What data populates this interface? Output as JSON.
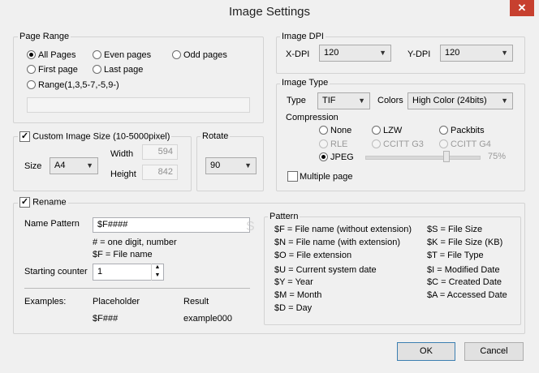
{
  "window": {
    "title": "Image Settings",
    "close_glyph": "✕"
  },
  "page_range": {
    "label": "Page Range",
    "options": [
      "All Pages",
      "Even pages",
      "Odd pages",
      "First page",
      "Last page",
      "Range(1,3,5-7,-5,9-)"
    ],
    "selected": "All Pages",
    "range_value": ""
  },
  "image_dpi": {
    "label": "Image DPI",
    "x_label": "X-DPI",
    "x_value": "120",
    "y_label": "Y-DPI",
    "y_value": "120"
  },
  "image_type": {
    "label": "Image Type",
    "type_label": "Type",
    "type_value": "TIF",
    "colors_label": "Colors",
    "colors_value": "High Color (24bits)",
    "compression_label": "Compression",
    "compression_options": [
      "None",
      "LZW",
      "Packbits",
      "RLE",
      "CCITT G3",
      "CCITT G4",
      "JPEG"
    ],
    "selected": "JPEG",
    "jpeg_quality": "75%",
    "quality_fraction": 0.75,
    "multiple_page_label": "Multiple page"
  },
  "custom_size": {
    "label": "Custom Image Size (10-5000pixel)",
    "checked": true,
    "size_label": "Size",
    "size_value": "A4",
    "width_label": "Width",
    "width_value": "594",
    "height_label": "Height",
    "height_value": "842"
  },
  "rotate": {
    "label": "Rotate",
    "value": "90"
  },
  "rename": {
    "label": "Rename",
    "checked": true,
    "name_pattern_label": "Name Pattern",
    "name_pattern_value": "$F####",
    "hint1": "# = one digit, number",
    "hint2": "$F = File name",
    "starting_counter_label": "Starting counter",
    "starting_counter_value": "1",
    "examples_label": "Examples:",
    "placeholder_header": "Placeholder",
    "result_header": "Result",
    "placeholder_value": "$F###",
    "result_value": "example000"
  },
  "pattern": {
    "label": "Pattern",
    "left": [
      "$F = File name (without extension)",
      "$N = File name (with extension)",
      "$O = File extension",
      "$U = Current system date",
      "$Y = Year",
      "$M = Month",
      "$D = Day"
    ],
    "right": [
      "$S = File Size",
      "$K = File Size (KB)",
      "$T = File Type",
      "$I = Modified Date",
      "$C = Created Date",
      "$A = Accessed Date"
    ]
  },
  "buttons": {
    "ok": "OK",
    "cancel": "Cancel"
  },
  "watermark": "S"
}
